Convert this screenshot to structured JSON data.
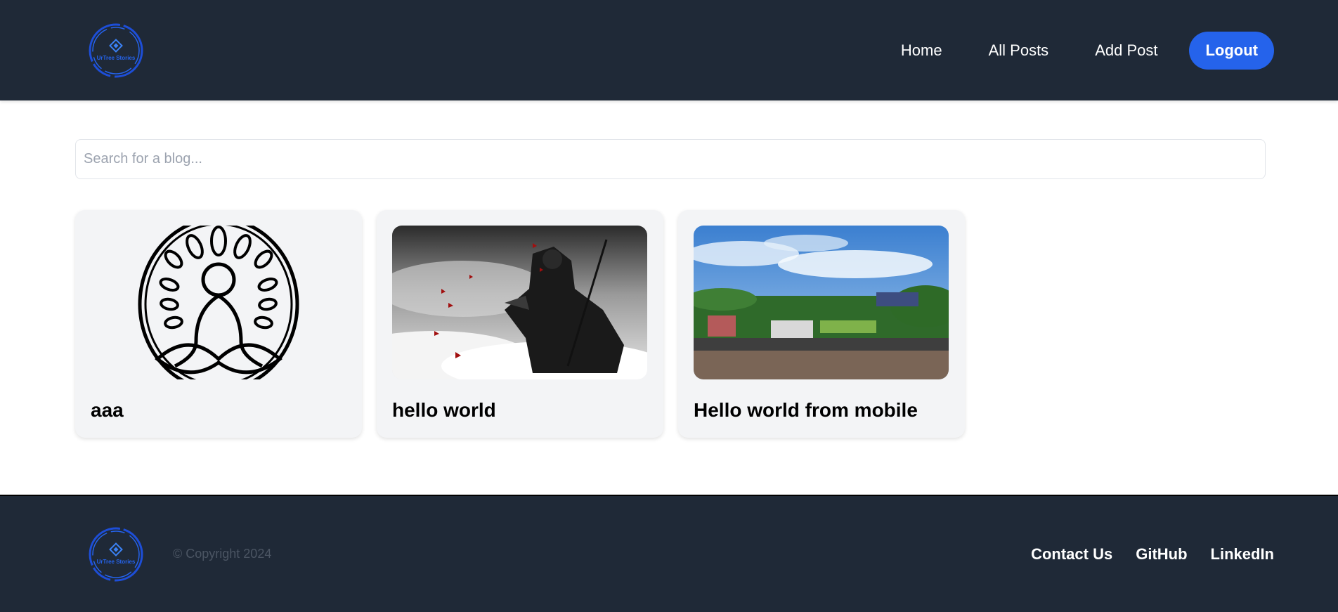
{
  "brand": {
    "logo_text": "UrTree Stories"
  },
  "nav": {
    "items": [
      {
        "label": "Home"
      },
      {
        "label": "All Posts"
      },
      {
        "label": "Add Post"
      }
    ],
    "logout_label": "Logout"
  },
  "search": {
    "placeholder": "Search for a blog...",
    "value": ""
  },
  "posts": [
    {
      "title": "aaa",
      "image": "meditation-tree-icon"
    },
    {
      "title": "hello world",
      "image": "samurai-artwork"
    },
    {
      "title": "Hello world from mobile",
      "image": "cityscape-photo"
    }
  ],
  "footer": {
    "copyright": "© Copyright 2024",
    "links": [
      {
        "label": "Contact Us"
      },
      {
        "label": "GitHub"
      },
      {
        "label": "LinkedIn"
      }
    ]
  },
  "colors": {
    "header_bg": "#1f2937",
    "accent": "#2563eb",
    "card_bg": "#f3f4f6"
  }
}
